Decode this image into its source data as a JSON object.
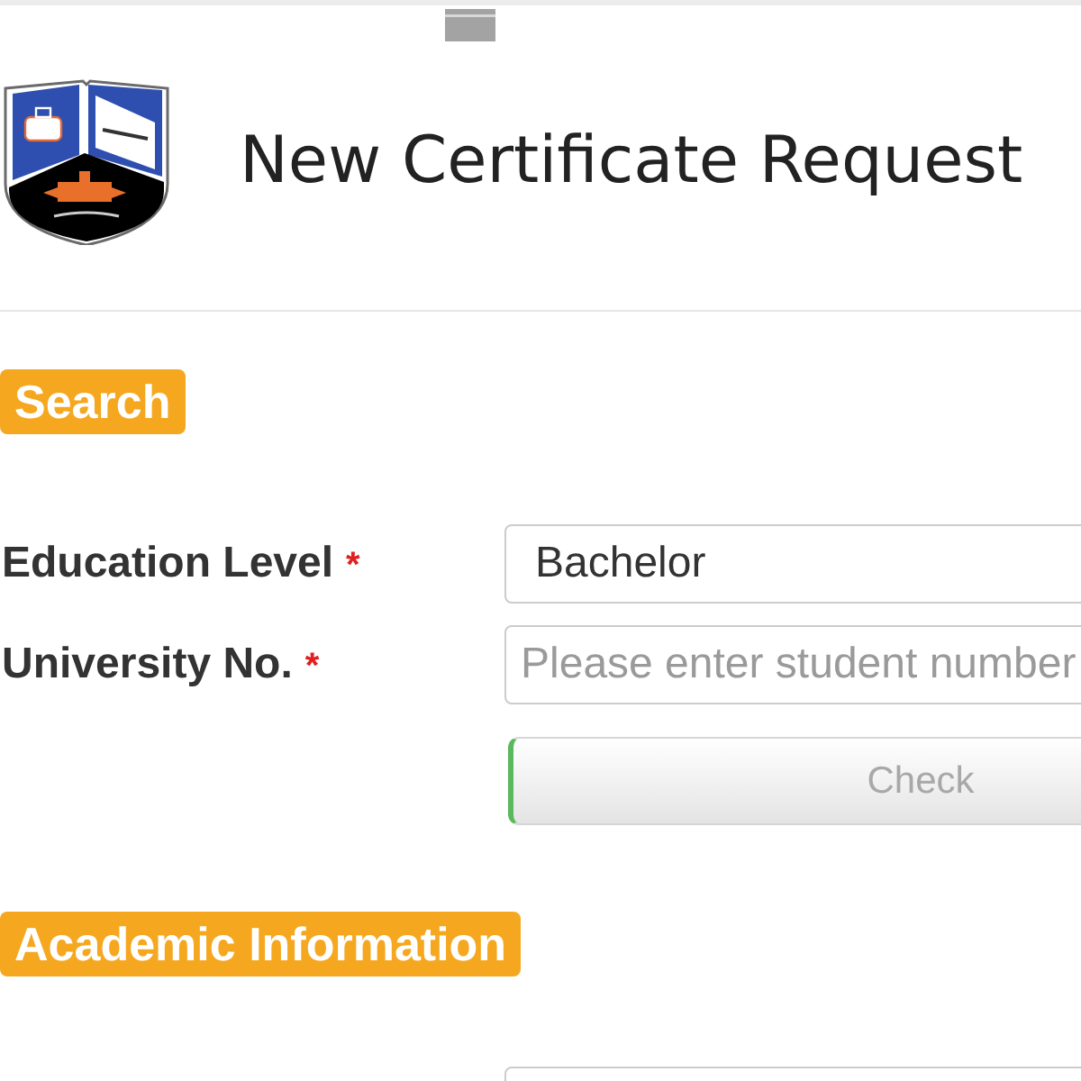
{
  "header": {
    "title": "New Certificate Request"
  },
  "sections": [
    {
      "title": "Search",
      "fields": [
        {
          "kind": "select",
          "label": "Education Level",
          "required_mark": "*",
          "value": "Bachelor"
        },
        {
          "kind": "input",
          "label": "University No.",
          "required_mark": "*",
          "placeholder": "Please enter student number"
        }
      ],
      "button": {
        "label": "Check",
        "disabled": true
      }
    },
    {
      "title": "Academic Information",
      "fields": [
        {
          "kind": "input"
        }
      ]
    }
  ]
}
